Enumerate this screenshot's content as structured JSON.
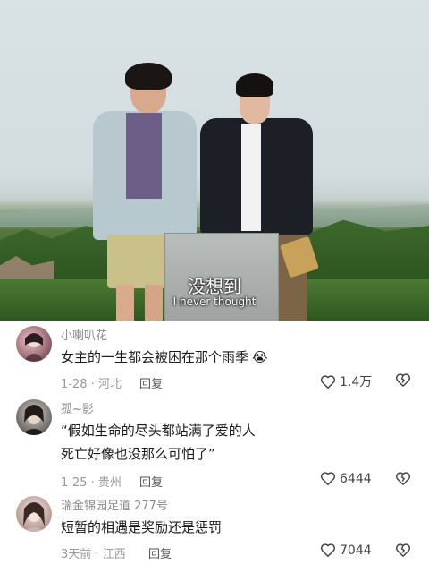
{
  "video": {
    "subtitle_cn": "没想到",
    "subtitle_en": "I never thought"
  },
  "comments": [
    {
      "username": "小喇叭花",
      "text_lines": [
        "女主的一生都会被困在那个雨季"
      ],
      "emoji": "😭",
      "date": "1-28",
      "location": "河北",
      "reply_label": "回复",
      "likes": "1.4万"
    },
    {
      "username": "孤~影",
      "text_lines": [
        "“假如生命的尽头都站满了爱的人",
        "死亡好像也没那么可怕了”"
      ],
      "date": "1-25",
      "location": "贵州",
      "reply_label": "回复",
      "likes": "6444"
    },
    {
      "username": "瑞金锦园足道 277号",
      "text_lines": [
        "短暂的相遇是奖励还是惩罚"
      ],
      "date": "3天前",
      "location": "江西",
      "reply_label": "回复",
      "likes": "7044"
    }
  ],
  "colors": {
    "meta_gray": "#9a9a9a",
    "text": "#1a1a1a",
    "bg": "#ffffff"
  }
}
